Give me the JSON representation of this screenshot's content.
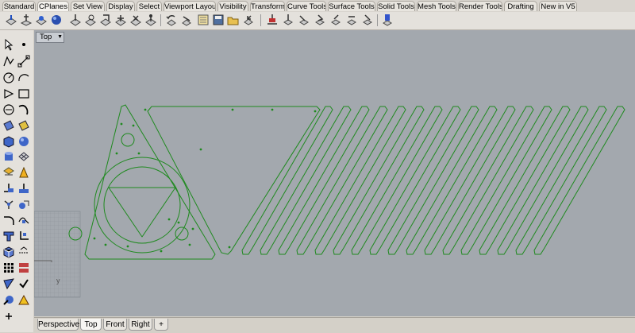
{
  "tabs": [
    "Standard",
    "CPlanes",
    "Set View",
    "Display",
    "Select",
    "Viewport Layout",
    "Visibility",
    "Transform",
    "Curve Tools",
    "Surface Tools",
    "Solid Tools",
    "Mesh Tools",
    "Render Tools",
    "Drafting",
    "New in V5"
  ],
  "active_tab": "CPlanes",
  "viewport": {
    "title": "Top",
    "menu_icon": "chevron-down-icon"
  },
  "viewport_tabs": [
    "Perspective",
    "Top",
    "Front",
    "Right"
  ],
  "active_viewport_tab": "Top",
  "add_viewport_icon": "plus-icon",
  "colors": {
    "curve": "#1f8a1f",
    "viewport_bg": "#a3a8ae",
    "grid": "#8f949a"
  }
}
